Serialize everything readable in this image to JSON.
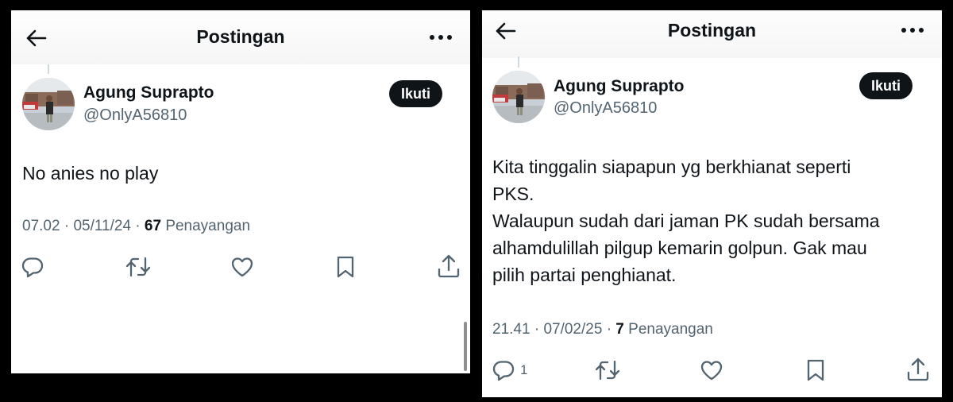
{
  "header": {
    "title": "Postingan"
  },
  "posts": [
    {
      "author": {
        "name": "Agung Suprapto",
        "handle": "@OnlyA56810",
        "follow_label": "Ikuti"
      },
      "text": "No anies no play",
      "time": "07.02",
      "date": "05/11/24",
      "views": "67",
      "views_label": "Penayangan",
      "separator": "·",
      "actions": {
        "reply_icon": "reply-icon",
        "retweet_icon": "retweet-icon",
        "like_icon": "heart-icon",
        "bookmark_icon": "bookmark-icon",
        "share_icon": "share-icon"
      }
    },
    {
      "author": {
        "name": "Agung Suprapto",
        "handle": "@OnlyA56810",
        "follow_label": "Ikuti"
      },
      "text": "Kita tinggalin siapapun yg berkhianat seperti\nPKS.\nWalaupun sudah dari jaman PK sudah bersama\nalhamdulillah pilgup kemarin golpun. Gak mau\npilih partai penghianat.",
      "time": "21.41",
      "date": "07/02/25",
      "views": "7",
      "views_label": "Penayangan",
      "separator": "·",
      "reply_count": "1",
      "actions": {
        "reply_icon": "reply-icon",
        "retweet_icon": "retweet-icon",
        "like_icon": "heart-icon",
        "bookmark_icon": "bookmark-icon",
        "share_icon": "share-icon"
      }
    }
  ],
  "colors": {
    "text": "#0f1419",
    "secondary": "#536471",
    "button_bg": "#0f1419",
    "button_text": "#ffffff",
    "background": "#000000"
  }
}
